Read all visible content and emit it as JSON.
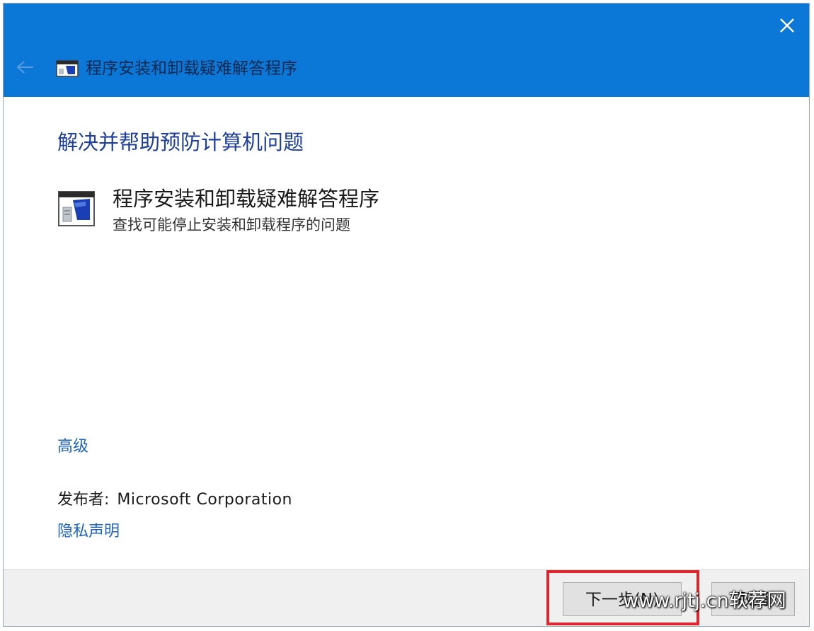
{
  "window": {
    "title": "程序安装和卸载疑难解答程序"
  },
  "content": {
    "heading": "解决并帮助预防计算机问题",
    "task_title": "程序安装和卸载疑难解答程序",
    "task_description": "查找可能停止安装和卸载程序的问题",
    "advanced_link": "高级",
    "publisher_label": "发布者:",
    "publisher_value": "Microsoft Corporation",
    "privacy_link": "隐私声明"
  },
  "footer": {
    "next_button": "下一步(N)",
    "cancel_button": "取消"
  },
  "watermark": {
    "text": "www.rjtj.cn软荐网"
  },
  "icons": {
    "close": "close-icon",
    "back": "back-arrow-icon",
    "app": "troubleshooter-app-icon"
  },
  "colors": {
    "titlebar": "#0b78d7",
    "heading": "#1e3f9a",
    "link": "#1c64c0",
    "highlight": "#e0262d"
  }
}
